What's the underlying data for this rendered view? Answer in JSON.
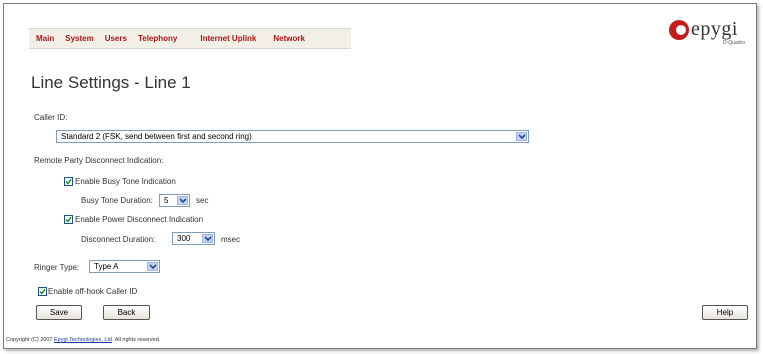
{
  "menu": {
    "items": [
      "Main",
      "System",
      "Users",
      "Telephony",
      "Internet Uplink",
      "Network"
    ]
  },
  "logo": {
    "brand": "epygi",
    "sub": "D-Quadro"
  },
  "page": {
    "title": "Line Settings - Line 1",
    "caller_id_label": "Caller ID:",
    "caller_id_value": "Standard 2 (FSK, send between first and second ring)",
    "remote_label": "Remote Party Disconnect Indication:",
    "busy_tone_check_label": "Enable Busy Tone Indication",
    "busy_tone_duration_label": "Busy Tone Duration:",
    "busy_tone_duration_value": "5",
    "busy_tone_unit": "sec",
    "power_disconnect_check_label": "Enable Power Disconnect Indication",
    "disconnect_duration_label": "Disconnect Duration:",
    "disconnect_duration_value": "300",
    "disconnect_unit": "msec",
    "ringer_label": "Ringer Type:",
    "ringer_value": "Type A",
    "offhook_check_label": "Enable off-hook Caller ID"
  },
  "buttons": {
    "save": "Save",
    "back": "Back",
    "help": "Help"
  },
  "footer": {
    "prefix": "Copyright (C) 2007",
    "link": "Epygi Technologies, Ltd",
    "suffix": ". All rights reserved."
  },
  "colors": {
    "menu_text": "#a81a1a",
    "menu_bg": "#f1efe6",
    "check": "#1f8a1f"
  }
}
